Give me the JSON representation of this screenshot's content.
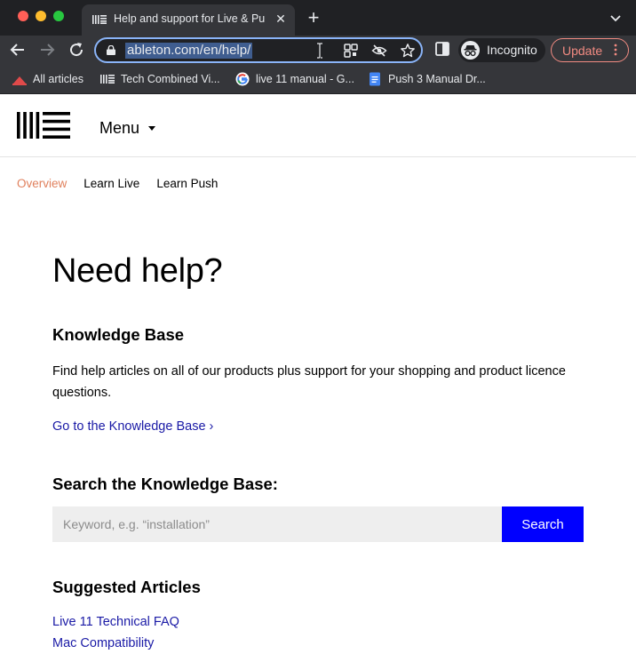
{
  "browser": {
    "tab": {
      "title": "Help and support for Live & Pu",
      "close_glyph": "✕"
    },
    "new_tab_glyph": "+",
    "address_bar": {
      "url": "ableton.com/en/help/"
    },
    "incognito_label": "Incognito",
    "update_label": "Update",
    "bookmarks": [
      {
        "label": "All articles",
        "icon": "ableton-bookmark-icon"
      },
      {
        "label": "Tech Combined Vi...",
        "icon": "ableton-bookmark-icon"
      },
      {
        "label": "live 11 manual - G...",
        "icon": "google-icon"
      },
      {
        "label": "Push 3 Manual Dr...",
        "icon": "google-docs-icon"
      }
    ],
    "colors": {
      "frame": "#202124",
      "toolbar": "#35363a",
      "focus_ring": "#8ab4f8",
      "update_accent": "#f28b82"
    }
  },
  "site": {
    "menu_label": "Menu",
    "subnav": [
      {
        "label": "Overview",
        "active": true
      },
      {
        "label": "Learn Live",
        "active": false
      },
      {
        "label": "Learn Push",
        "active": false
      }
    ],
    "page_title": "Need help?",
    "knowledge_base": {
      "heading": "Knowledge Base",
      "description": "Find help articles on all of our products plus support for your shopping and product licence questions.",
      "link_label": "Go to the Knowledge Base ›"
    },
    "search": {
      "heading": "Search the Knowledge Base:",
      "placeholder": "Keyword, e.g. “installation”",
      "button_label": "Search"
    },
    "suggested": {
      "heading": "Suggested Articles",
      "articles": [
        "Live 11 Technical FAQ",
        "Mac Compatibility"
      ]
    },
    "colors": {
      "active_nav": "#e0805d",
      "link": "#1a1aa6",
      "search_button": "#0000ff",
      "search_field": "#eeeeee"
    }
  }
}
